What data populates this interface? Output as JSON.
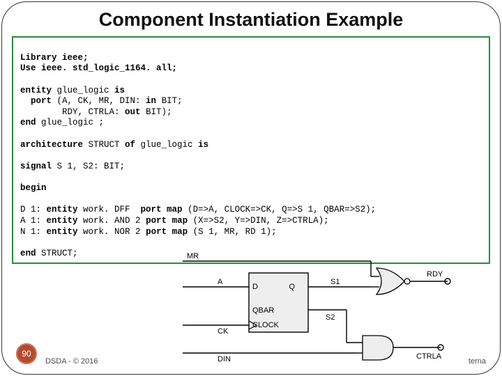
{
  "title": "Component Instantiation Example",
  "code": {
    "l1": "Library ieee;",
    "l2": "Use ieee. std_logic_1164. all;",
    "l3a": "entity",
    "l3b": " glue_logic ",
    "l3c": "is",
    "l4a": "  port",
    "l4b": " (A, CK, MR, DIN: ",
    "l4c": "in",
    "l4d": " BIT;",
    "l5a": "        RDY, CTRLA: ",
    "l5b": "out",
    "l5c": " BIT);",
    "l6a": "end",
    "l6b": " glue_logic ;",
    "l7a": "architecture",
    "l7b": " STRUCT ",
    "l7c": "of",
    "l7d": " glue_logic ",
    "l7e": "is",
    "l8a": "signal",
    "l8b": " S 1, S2: BIT;",
    "l9": "begin",
    "l10a": "D 1: ",
    "l10b": "entity",
    "l10c": " work. DFF  ",
    "l10d": "port map",
    "l10e": " (D=>A, CLOCK=>CK, Q=>S 1, QBAR=>S2);",
    "l11a": "A 1: ",
    "l11b": "entity",
    "l11c": " work. AND 2 ",
    "l11d": "port map",
    "l11e": " (X=>S2, Y=>DIN, Z=>CTRLA);",
    "l12a": "N 1: ",
    "l12b": "entity",
    "l12c": " work. NOR 2 ",
    "l12d": "port map",
    "l12e": " (S 1, MR, RD 1);",
    "l13a": "end ",
    "l13b": "STRUCT;"
  },
  "diagram": {
    "labels": {
      "MR": "MR",
      "A": "A",
      "CK": "CK",
      "DIN": "DIN",
      "D": "D",
      "CLOCK": "CLOCK",
      "QBAR": "QBAR",
      "Q": "Q",
      "S1": "S1",
      "S2": "S2",
      "RDY": "RDY",
      "CTRLA": "CTRLA"
    }
  },
  "pageNumber": "90",
  "footerLeft": "DSDA - © 2016",
  "footerRight": "terna"
}
